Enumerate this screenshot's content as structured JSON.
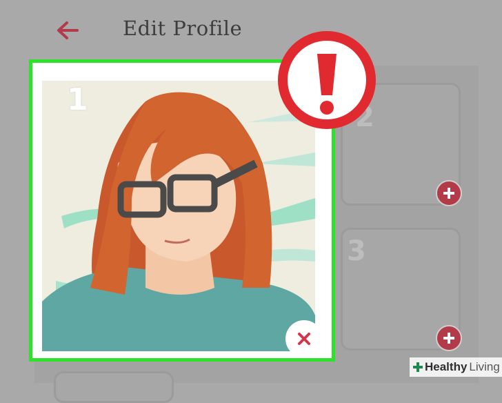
{
  "header": {
    "title": "Edit Profile",
    "back_icon": "arrow-left-icon"
  },
  "photos": {
    "main_slot_number": "1",
    "slot_2_number": "2",
    "slot_3_number": "3",
    "add_icon": "plus-icon",
    "remove_icon": "close-icon"
  },
  "warning": {
    "icon": "exclamation-icon",
    "color": "#e02a2f"
  },
  "colors": {
    "accent": "#b33a49",
    "highlight": "#2fe12a"
  },
  "watermark": {
    "part1": "Healthy",
    "part2": "Living"
  }
}
